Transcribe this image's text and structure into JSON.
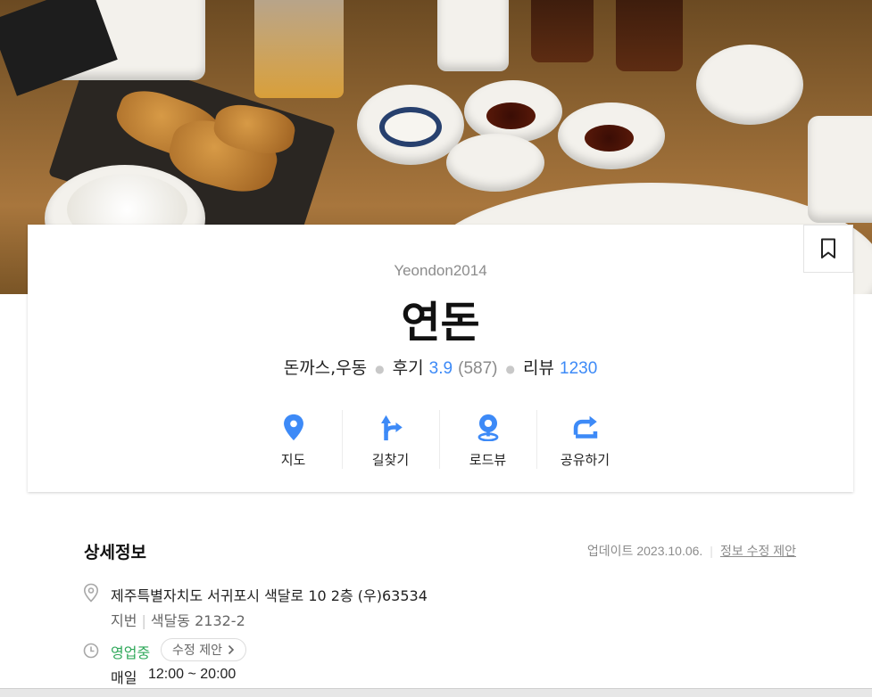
{
  "place": {
    "english_name": "Yeondon2014",
    "name": "연돈",
    "category": "돈까스,우동",
    "review_label": "후기",
    "rating": "3.9",
    "rating_count": "(587)",
    "blog_review_label": "리뷰",
    "blog_review_count": "1230"
  },
  "actions": [
    {
      "label": "지도",
      "icon": "map-pin-icon"
    },
    {
      "label": "길찾기",
      "icon": "directions-icon"
    },
    {
      "label": "로드뷰",
      "icon": "roadview-icon"
    },
    {
      "label": "공유하기",
      "icon": "share-icon"
    }
  ],
  "details": {
    "section_title": "상세정보",
    "updated": "업데이트 2023.10.06.",
    "suggest_edit": "정보 수정 제안",
    "address": "제주특별자치도 서귀포시 색달로 10 2층 (우)63534",
    "jibun_label": "지번",
    "jibun": "색달동 2132-2",
    "open_status": "영업중",
    "chip_label": "수정 제안",
    "hours_day": "매일",
    "hours_time": "12:00 ~ 20:00"
  },
  "colors": {
    "accent_blue": "#3d8af7",
    "open_green": "#2fa85a"
  }
}
